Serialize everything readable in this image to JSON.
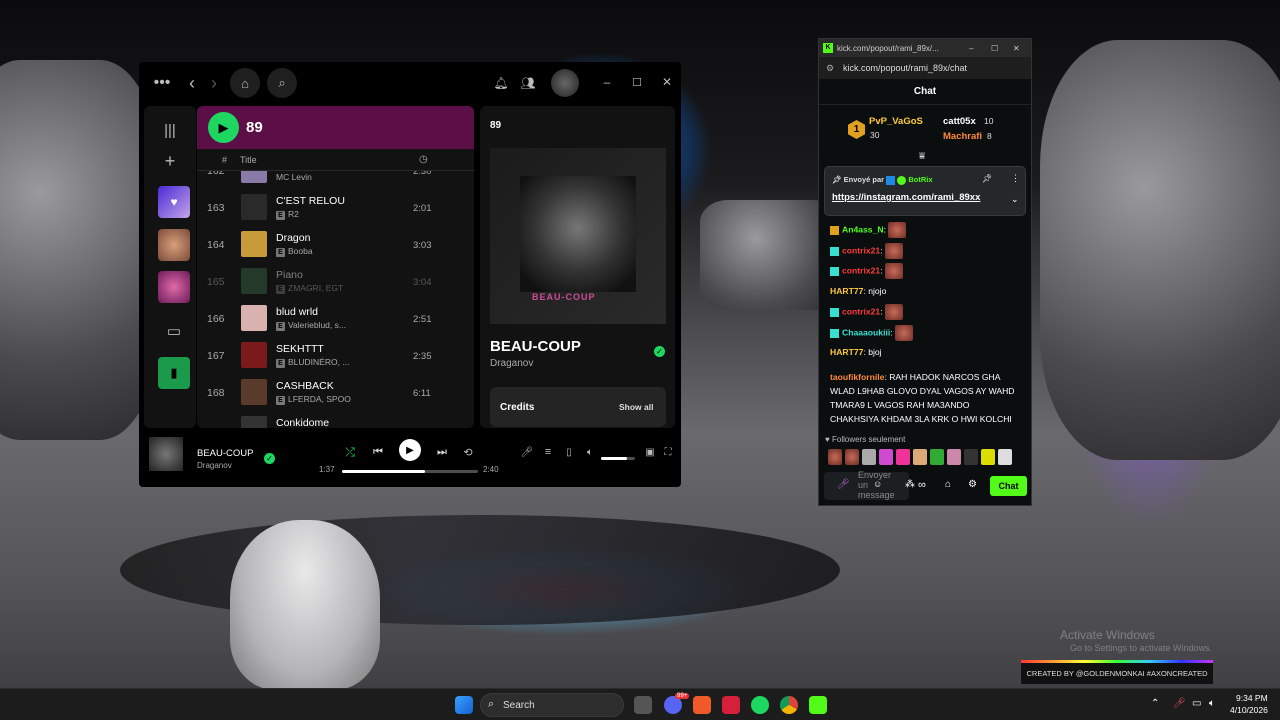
{
  "desktop": {
    "watermark_line1": "Activate Windows",
    "watermark_line2": "Go to Settings to activate Windows.",
    "credit": "CREATED BY @GOLDENMONKAI  #AXONCREATED"
  },
  "spotify": {
    "playlist_title": "89",
    "columns": {
      "num": "#",
      "title": "Title"
    },
    "tracks": [
      {
        "num": "162",
        "title": "",
        "artist": "MC Levin",
        "explicit": false,
        "dur": "2:30",
        "dim": false,
        "art": "#8a7aa8"
      },
      {
        "num": "163",
        "title": "C'EST RELOU",
        "artist": "R2",
        "explicit": true,
        "dur": "2:01",
        "dim": false,
        "art": "#2a2a2a"
      },
      {
        "num": "164",
        "title": "Dragon",
        "artist": "Booba",
        "explicit": true,
        "dur": "3:03",
        "dim": false,
        "art": "#c79a3a"
      },
      {
        "num": "165",
        "title": "Piano",
        "artist": "ZMAGRI, EGT",
        "explicit": true,
        "dur": "3:04",
        "dim": true,
        "art": "#3c6a4a"
      },
      {
        "num": "166",
        "title": "blud wrld",
        "artist": "Valerieblud, s...",
        "explicit": true,
        "dur": "2:51",
        "dim": false,
        "art": "#d9b2b0"
      },
      {
        "num": "167",
        "title": "SEKHTTT",
        "artist": "BLUDINÉRO, ...",
        "explicit": true,
        "dur": "2:35",
        "dim": false,
        "art": "#7a1a1a"
      },
      {
        "num": "168",
        "title": "CASHBACK",
        "artist": "LFERDA, SPOO",
        "explicit": true,
        "dur": "6:11",
        "dim": false,
        "art": "#5a3a2a"
      },
      {
        "num": "",
        "title": "Conkidome",
        "artist": "",
        "explicit": false,
        "dur": "",
        "dim": false,
        "art": "#333333"
      }
    ],
    "right_panel": {
      "header": "89",
      "song": "BEAU-COUP",
      "artist": "Draganov",
      "cover_text": "BEAU-COUP",
      "credits_label": "Credits",
      "show_all": "Show all"
    },
    "now_playing": {
      "title": "BEAU-COUP",
      "artist": "Draganov",
      "elapsed": "1:37",
      "total": "2:40",
      "progress": 0.61,
      "volume": 0.75
    }
  },
  "kick": {
    "tab_title": "kick.com/popout/rami_89x/...",
    "url": "kick.com/popout/rami_89x/chat",
    "chat_header": "Chat",
    "leaderboard": [
      {
        "rank": "1",
        "name": "PvP_VaGoS",
        "count": "30"
      },
      {
        "name": "catt05x",
        "count": "10"
      },
      {
        "name": "Machrafi",
        "count": "8"
      }
    ],
    "pinned": {
      "sent_by": "Envoyé par",
      "bot": "BotRix",
      "link": "https://instagram.com/rami_89xx"
    },
    "messages": [
      {
        "user": "An4ass_N",
        "color": "#53fc18",
        "text": "",
        "emote": true
      },
      {
        "user": "contrix21",
        "color": "#ff3b3b",
        "text": "",
        "emote": true
      },
      {
        "user": "contrix21",
        "color": "#ff3b3b",
        "text": "",
        "emote": true
      },
      {
        "user": "HART77",
        "color": "#ffc93b",
        "text": "njojo",
        "emote": false
      },
      {
        "user": "contrix21",
        "color": "#ff3b3b",
        "text": "",
        "emote": true
      },
      {
        "user": "Chaaaoukiii",
        "color": "#39e0d1",
        "text": "",
        "emote": true
      },
      {
        "user": "HART77",
        "color": "#ffc93b",
        "text": "bjoj",
        "emote": false
      }
    ],
    "long_msg": {
      "user": "taoufikfornile",
      "color": "#ff8a3b",
      "lines": [
        "RAH HADOK NARCOS GHA",
        "WLAD L9HAB GLOVO DYAL VAGOS AY WAHD",
        "TMARA9 L VAGOS RAH MA3ANDO",
        "CHAKHSIYA KHDAM 3LA KRK O HWI KOLCHI"
      ]
    },
    "followers_only": "Followers seulement",
    "input_placeholder": "Envoyer un message",
    "send_label": "Chat"
  },
  "taskbar": {
    "search": "Search",
    "time": "9:34 PM",
    "date": "4/10/2026",
    "badge": "99+"
  },
  "colors": {
    "spotify_green": "#1ed760",
    "kick_green": "#53fc18",
    "playlist_header": "#5c0f46"
  }
}
